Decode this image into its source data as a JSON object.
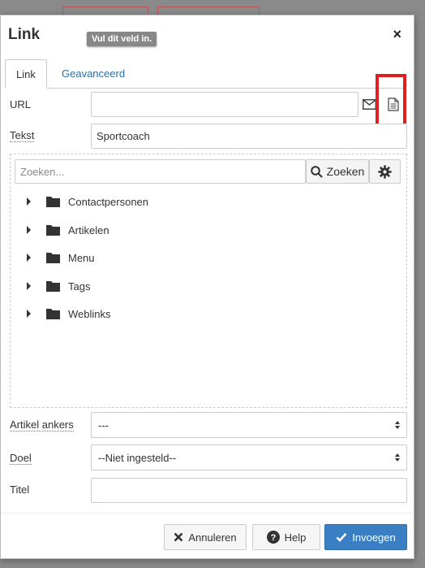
{
  "dialog": {
    "title": "Link",
    "tooltip": "Vul dit veld in.",
    "close_icon": "×"
  },
  "tabs": [
    {
      "label": "Link",
      "active": true
    },
    {
      "label": "Geavanceerd",
      "active": false
    }
  ],
  "form": {
    "url_label": "URL",
    "url_value": "",
    "text_label": "Tekst",
    "text_value": "Sportcoach",
    "anchors_label": "Artikel ankers",
    "anchors_value": "---",
    "target_label": "Doel",
    "target_value": "--Niet ingesteld--",
    "title_label": "Titel",
    "title_value": ""
  },
  "browser": {
    "search_placeholder": "Zoeken...",
    "search_button": "Zoeken",
    "tree": [
      {
        "label": "Contactpersonen"
      },
      {
        "label": "Artikelen"
      },
      {
        "label": "Menu"
      },
      {
        "label": "Tags"
      },
      {
        "label": "Weblinks"
      }
    ]
  },
  "buttons": {
    "cancel": "Annuleren",
    "help": "Help",
    "insert": "Invoegen"
  },
  "colors": {
    "accent": "#3a7ec4",
    "tab_link": "#2a6fa8",
    "highlight": "#e02020"
  }
}
